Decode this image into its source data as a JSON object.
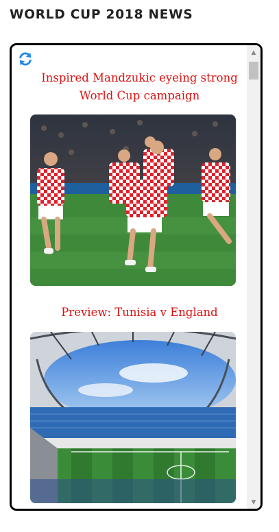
{
  "page": {
    "title": "WORLD CUP 2018 NEWS"
  },
  "widget": {
    "refresh_icon": "refresh-icon",
    "accent_color": "#1e88e5",
    "headline_color": "#dd1111"
  },
  "news": [
    {
      "headline": "Inspired Mandzukic eyeing strong World Cup campaign",
      "image": "croatia-players-celebrating-photo"
    },
    {
      "headline": "Preview: Tunisia v England",
      "image": "stadium-interior-photo"
    }
  ],
  "scrollbar": {
    "up_icon": "scroll-up-arrow-icon",
    "down_icon": "scroll-down-arrow-icon"
  }
}
